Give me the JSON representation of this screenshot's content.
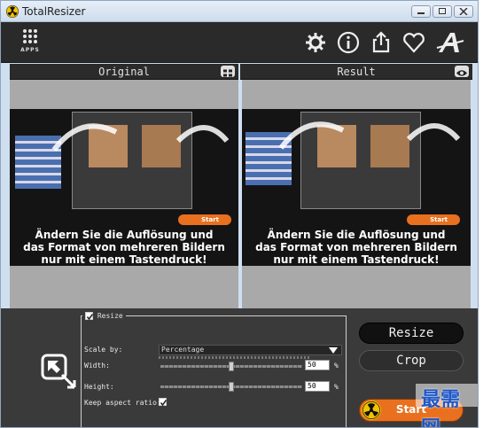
{
  "window": {
    "title": "TotalResizer"
  },
  "toolbar": {
    "apps_label": "APPS"
  },
  "panes": {
    "original": {
      "label": "Original"
    },
    "result": {
      "label": "Result"
    }
  },
  "promo": {
    "line1": "Ändern Sie die Auflösung und",
    "line2": "das Format von mehreren Bildern",
    "line3": "nur mit einem Tastendruck!",
    "start_label": "Start"
  },
  "resize_group": {
    "title": "Resize",
    "checked": true,
    "scale_by_label": "Scale by:",
    "scale_by_value": "Percentage",
    "width_label": "Width:",
    "width_value": "50",
    "height_label": "Height:",
    "height_value": "50",
    "unit": "%",
    "width_slider_fraction": 0.5,
    "height_slider_fraction": 0.5,
    "keep_aspect_label": "Keep aspect ratio:",
    "keep_aspect_checked": true
  },
  "actions": {
    "resize_label": "Resize",
    "crop_label": "Crop",
    "start_label": "Start"
  },
  "watermark": {
    "text": "最需网"
  },
  "colors": {
    "accent": "#e8701e",
    "toolbar": "#2a2a2a",
    "panel": "#3a3a3a",
    "watermark": "#1f57c8"
  }
}
